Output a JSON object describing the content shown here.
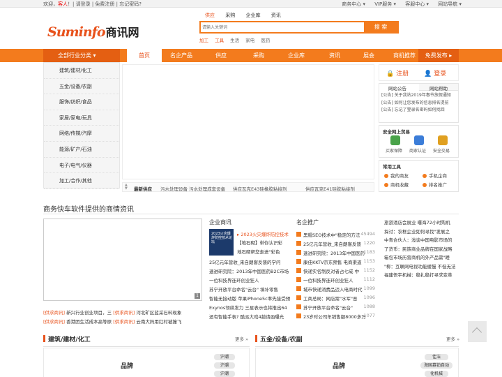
{
  "topbar": {
    "welcome": "欢迎，",
    "guest": "客人",
    "sep": "！|",
    "login": "请登录",
    "register": "免费注册",
    "forgot": "忘记密码?",
    "links": [
      "商务中心 ▾",
      "VIP服务 ▾",
      "客服中心 ▾",
      "网站导航 ▾"
    ]
  },
  "logo": {
    "en": "Suminfo",
    "cn": "商讯网"
  },
  "search": {
    "tabs": [
      "供应",
      "采购",
      "企业库",
      "资讯"
    ],
    "active_tab": "供应",
    "placeholder": "请输入关键词",
    "button": "搜 索",
    "hotwords": [
      "加工",
      "工具",
      "生活",
      "家电",
      "医药"
    ]
  },
  "nav": {
    "all_categories": "全部行业分类 ▾",
    "items": [
      "首页",
      "名企产品",
      "供应",
      "采购",
      "企业库",
      "资讯",
      "展会",
      "商机推荐"
    ],
    "active": "首页",
    "publish": "免费发布 ▸"
  },
  "categories": [
    "建筑/建材/化工",
    "五金/设备/农副",
    "服饰/纺织/食品",
    "家居/家电/玩具",
    "网络/传媒/汽摩",
    "能源/矿产/石油",
    "电子/电气/仪器",
    "加工/合作/其他"
  ],
  "scroller": {
    "label": "最新供应",
    "items": [
      "污水处理设备 污水处理成套设备",
      "供应瓦克E43硅橡胶粘接剂",
      "供应瓦克E41硅胶粘接剂"
    ]
  },
  "sidebar": {
    "register": "注册",
    "login": "登录",
    "tabs": [
      "网站公告",
      "网站帮助"
    ],
    "notices": [
      "[公告] 关于我站2019年春节放假通知",
      "[公告] 如何让您发布的信息排名提前",
      "[公告] 忘记了登录名密码如何找回"
    ],
    "security_title": "安全网上贸易",
    "security_items": [
      "买家保障",
      "商家认证",
      "安全交易"
    ],
    "security_colors": [
      "#4aa34a",
      "#3b7dd8",
      "#e0a020"
    ],
    "tools_title": "常用工具",
    "tools": [
      "我的商友",
      "手机企商",
      "商机收藏",
      "排名推广"
    ]
  },
  "section": {
    "title": "商务快车软件提供的商情资讯",
    "image_badge": "1",
    "news": [
      {
        "tag": "[供求商讯]",
        "text": "新兴行业创业项目，三",
        "tag2": "[供求商讯]",
        "text2": "河北矿区蓝采石料现象"
      },
      {
        "tag": "[供求商讯]",
        "text": "香港团生活成本高等原",
        "tag2": "[供求商讯]",
        "text2": "云南大妈用红村被撞飞"
      }
    ],
    "qy_title": "企业商讯",
    "qy_head": "▸ 2023火灾爆炸防控技术",
    "qy_pic_text": "2023火灾爆炸防控技术论坛",
    "qy_lines": [
      "【地石砌】带你认识彩",
      "地石砌帮您走进\"彩色",
      "25亿元年营收_来自朗客反馈的学问",
      "速进研究院：2013年中国医药B2C市场",
      "一位科技界连环创业狂人",
      "苏宁开放平台命名\"云台\" 填补零售",
      "智能无接动版 苹果iPhone5c率先接受预",
      "Exynos领续发力 三星表示也将推出64",
      "还有智能手表? 酷派大戏4趟请函曝光"
    ],
    "rank_title": "名企推广",
    "rank": [
      {
        "text": "黑帽SEO技术中\"稳定的方法",
        "num": "45494"
      },
      {
        "text": "25亿元年营收_来自朗客反馈",
        "num": "1220"
      },
      {
        "text": "速进研究院：2013年中国医药",
        "num": "1183"
      },
      {
        "text": "康佳KKTV京东预售 电商渠道",
        "num": "1153"
      },
      {
        "text": "快递实名制反对者占七成 中",
        "num": "1152"
      },
      {
        "text": "一位科技界连环创业狂人",
        "num": "1112"
      },
      {
        "text": "城市快递消费品迈入电商时代",
        "num": "1099"
      },
      {
        "text": "工商总局：网店需\"水军\"恶",
        "num": "1096"
      },
      {
        "text": "苏宁开放平台命名\"云台\"",
        "num": "1088"
      },
      {
        "text": "23岁时公司年销售额8000多万",
        "num": "1077"
      }
    ],
    "right_lines": [
      "旅游酒店会展业 曝海72小时购机",
      "探讨：农框企业如何寻找\"发展之",
      "中青合伙人：浅谈中国电影市场的",
      "了货币：民族商业品牌在国家战略",
      "箱包市场历营商机的外产品需\"瞪",
      "\"柳：互联网电视功能缓慢 不但无法",
      "福建悟宇机械：稳扎稳打寻求变革"
    ]
  },
  "bottom": {
    "left_title": "建筑/建材/化工",
    "right_title": "五金/设备/农副",
    "more": "更多 »",
    "brand": "品牌",
    "left_chips": [
      "沪潮",
      "沪潮",
      "沪潮"
    ],
    "right_chips": [
      "佳洁",
      "海国慕铂自动",
      "化机械"
    ]
  }
}
